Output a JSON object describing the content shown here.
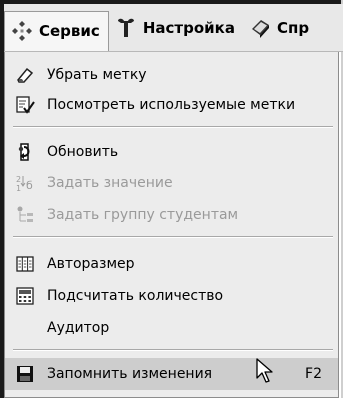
{
  "menubar": {
    "items": [
      {
        "label": "Сервис",
        "icon": "tools-diamond-icon"
      },
      {
        "label": "Настройка",
        "icon": "wrench-icon"
      },
      {
        "label": "Спр",
        "icon": "help-book-icon"
      }
    ]
  },
  "menu": {
    "items": [
      {
        "label": "Убрать метку",
        "icon": "eraser-icon",
        "enabled": true
      },
      {
        "label": "Посмотреть используемые метки",
        "icon": "check-document-icon",
        "enabled": true
      },
      {
        "label": "Обновить",
        "icon": "refresh-icon",
        "enabled": true
      },
      {
        "label": "Задать значение",
        "icon": "sort-values-icon",
        "enabled": false
      },
      {
        "label": "Задать группу студентам",
        "icon": "group-tree-icon",
        "enabled": false
      },
      {
        "label": "Авторазмер",
        "icon": "columns-autosize-icon",
        "enabled": true
      },
      {
        "label": "Подсчитать количество",
        "icon": "calculator-icon",
        "enabled": true
      },
      {
        "label": "Аудитор",
        "icon": "",
        "enabled": true
      },
      {
        "label": "Запомнить изменения",
        "icon": "save-floppy-icon",
        "enabled": true,
        "shortcut": "F2",
        "highlighted": true
      }
    ]
  }
}
